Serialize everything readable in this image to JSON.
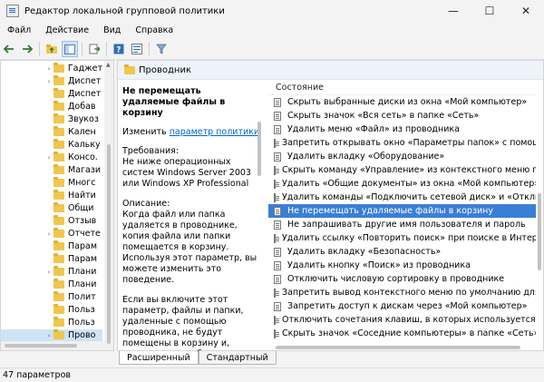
{
  "window": {
    "title": "Редактор локальной групповой политики",
    "minimize": "—",
    "maximize": "☐",
    "close": "✕"
  },
  "menu": [
    "Файл",
    "Действие",
    "Вид",
    "Справка"
  ],
  "toolbar": {
    "icons": [
      "back-icon",
      "forward-icon",
      "up-folder-icon",
      "show-tree-icon",
      "export-icon",
      "help-icon",
      "properties-icon",
      "filter-icon"
    ]
  },
  "tree": {
    "items": [
      {
        "label": "Гаджет",
        "arrow": "›"
      },
      {
        "label": "Диспет",
        "arrow": "›"
      },
      {
        "label": "Диспет",
        "arrow": ""
      },
      {
        "label": "Добав",
        "arrow": ""
      },
      {
        "label": "Звукоз",
        "arrow": ""
      },
      {
        "label": "Кален",
        "arrow": ""
      },
      {
        "label": "Кальку",
        "arrow": ""
      },
      {
        "label": "Консо.",
        "arrow": "›"
      },
      {
        "label": "Магази",
        "arrow": ""
      },
      {
        "label": "Многс",
        "arrow": ""
      },
      {
        "label": "Найти",
        "arrow": ""
      },
      {
        "label": "Общи",
        "arrow": ""
      },
      {
        "label": "Отзыв",
        "arrow": ""
      },
      {
        "label": "Отчете",
        "arrow": "›"
      },
      {
        "label": "Парам",
        "arrow": ""
      },
      {
        "label": "Парам",
        "arrow": ""
      },
      {
        "label": "Плани",
        "arrow": "›"
      },
      {
        "label": "Плани",
        "arrow": ""
      },
      {
        "label": "Полит",
        "arrow": ""
      },
      {
        "label": "Польз",
        "arrow": ""
      },
      {
        "label": "Польз",
        "arrow": ""
      },
      {
        "label": "Прово",
        "arrow": "›",
        "selected": true
      }
    ]
  },
  "main": {
    "header": "Проводник",
    "column_header": "Состояние"
  },
  "description": {
    "title": "Не перемещать удаляемые файлы в корзину",
    "edit_prefix": "Изменить",
    "edit_link": "параметр политики",
    "requirements_label": "Требования:",
    "requirements_text": "Не ниже операционных систем Windows Server 2003 или Windows XP Professional",
    "description_label": "Описание:",
    "description_text": "Когда файл или папка удаляется в проводнике, копия файла или папки помещается в корзину. Используя этот параметр, вы можете изменить это поведение.",
    "extra_text": "Если вы включите этот параметр, файлы и папки, удаленные с помощью проводника, не будут помещены в корзину и, следовательно, будут удалены без возможности восстановления."
  },
  "policies": [
    "Скрыть выбранные диски из окна «Мой компьютер»",
    "Скрыть значок «Вся сеть» в папке «Сеть»",
    "Удалить меню «Файл» из проводника",
    "Запретить открывать окно «Параметры папок» с помощ...",
    "Удалить вкладку «Оборудование»",
    "Скрыть команду «Управление» из контекстного меню пр...",
    "Удалить «Общие документы» из окна «Мой компьютер»",
    "Удалить команды «Подключить сетевой диск» и «Отклю...",
    "Не перемещать удаляемые файлы в корзину",
    "Не запрашивать другие имя пользователя и пароль",
    "Удалить ссылку «Повторить поиск» при поиске в Интерн...",
    "Удалить вкладку «Безопасность»",
    "Удалить кнопку «Поиск» из проводника",
    "Отключить числовую сортировку в проводнике",
    "Запретить вывод контекстного меню по умолчанию для ...",
    "Запретить доступ к дискам через «Мой компьютер»",
    "Отключить сочетания клавиш, в которых используется к...",
    "Скрыть значок «Соседние компьютеры» в папке «Сеть»"
  ],
  "selected_policy_index": 8,
  "tabs": [
    "Расширенный",
    "Стандартный"
  ],
  "status": "47 параметров"
}
